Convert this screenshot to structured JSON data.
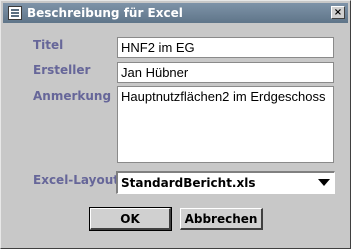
{
  "window": {
    "title": "Beschreibung für Excel",
    "close_symbol": "×",
    "title_icon": "document-icon"
  },
  "form": {
    "titel_label": "Titel",
    "titel_value": "HNF2 im EG",
    "ersteller_label": "Ersteller",
    "ersteller_value": "Jan Hübner",
    "anmerkung_label": "Anmerkung",
    "anmerkung_value": "Hauptnutzflächen2 im Erdgeschoss",
    "layouts_label": "Excel-Layouts",
    "layouts_selected": "StandardBericht.xls"
  },
  "buttons": {
    "ok": "OK",
    "cancel": "Abbrechen"
  }
}
